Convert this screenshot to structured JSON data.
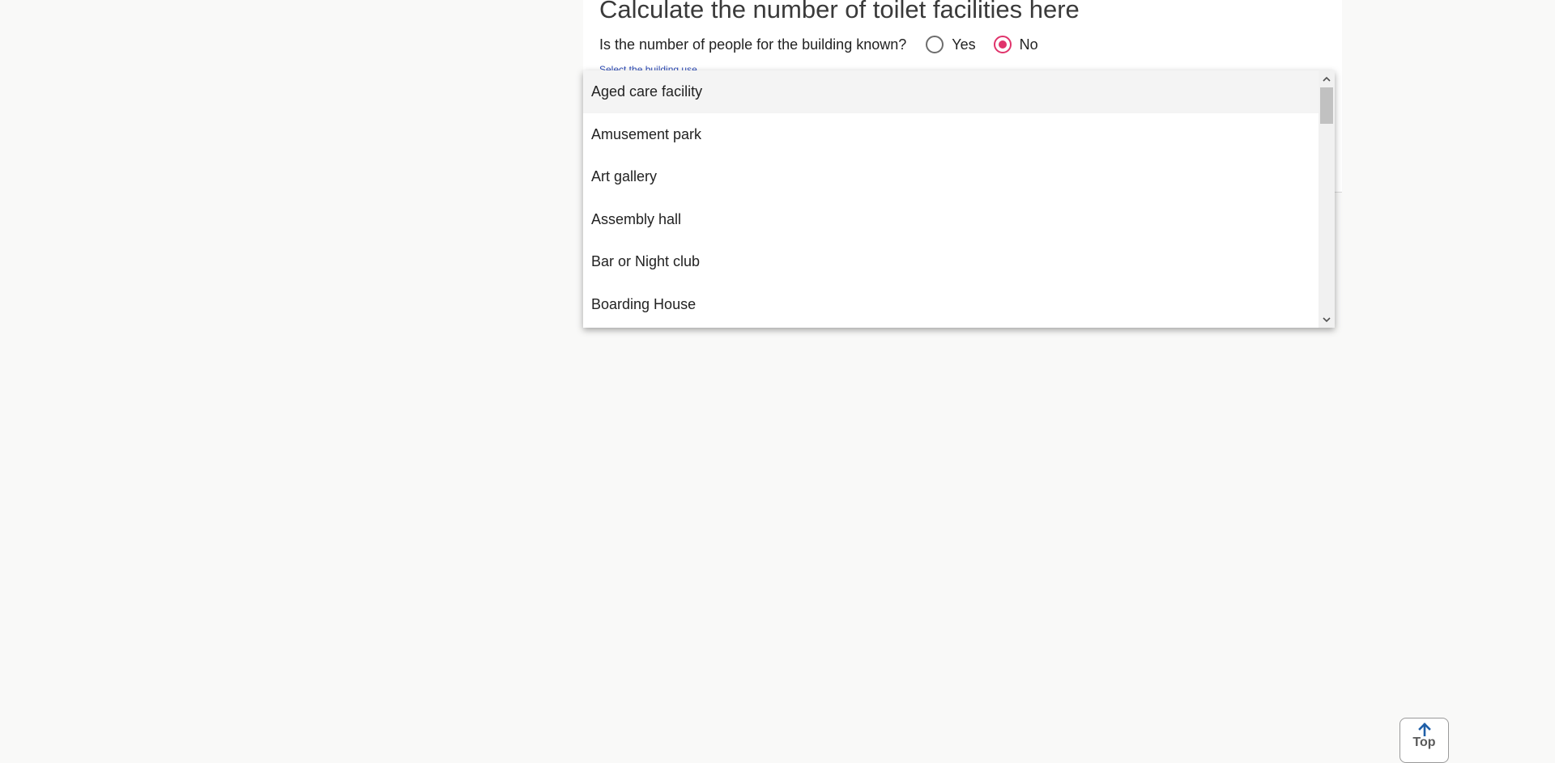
{
  "form": {
    "title": "Calculate the number of toilet facilities here",
    "question": "Is the number of people for the building known?",
    "radio_options": [
      {
        "label": "Yes",
        "checked": false
      },
      {
        "label": "No",
        "checked": true
      }
    ],
    "select_label": "Select the building use"
  },
  "dropdown": {
    "options": [
      "Aged care facility",
      "Amusement park",
      "Art gallery",
      "Assembly hall",
      "Bar or Night club",
      "Boarding House"
    ],
    "highlighted_option": "Aged care facility"
  },
  "scroll_to_top": {
    "label": "Top",
    "icon": "arrow-up-icon"
  },
  "colors": {
    "radio_accent": "#e0336b",
    "label_blue": "#2d4bb5",
    "top_arrow": "#1f5fa8",
    "background": "#f9f9f8"
  }
}
